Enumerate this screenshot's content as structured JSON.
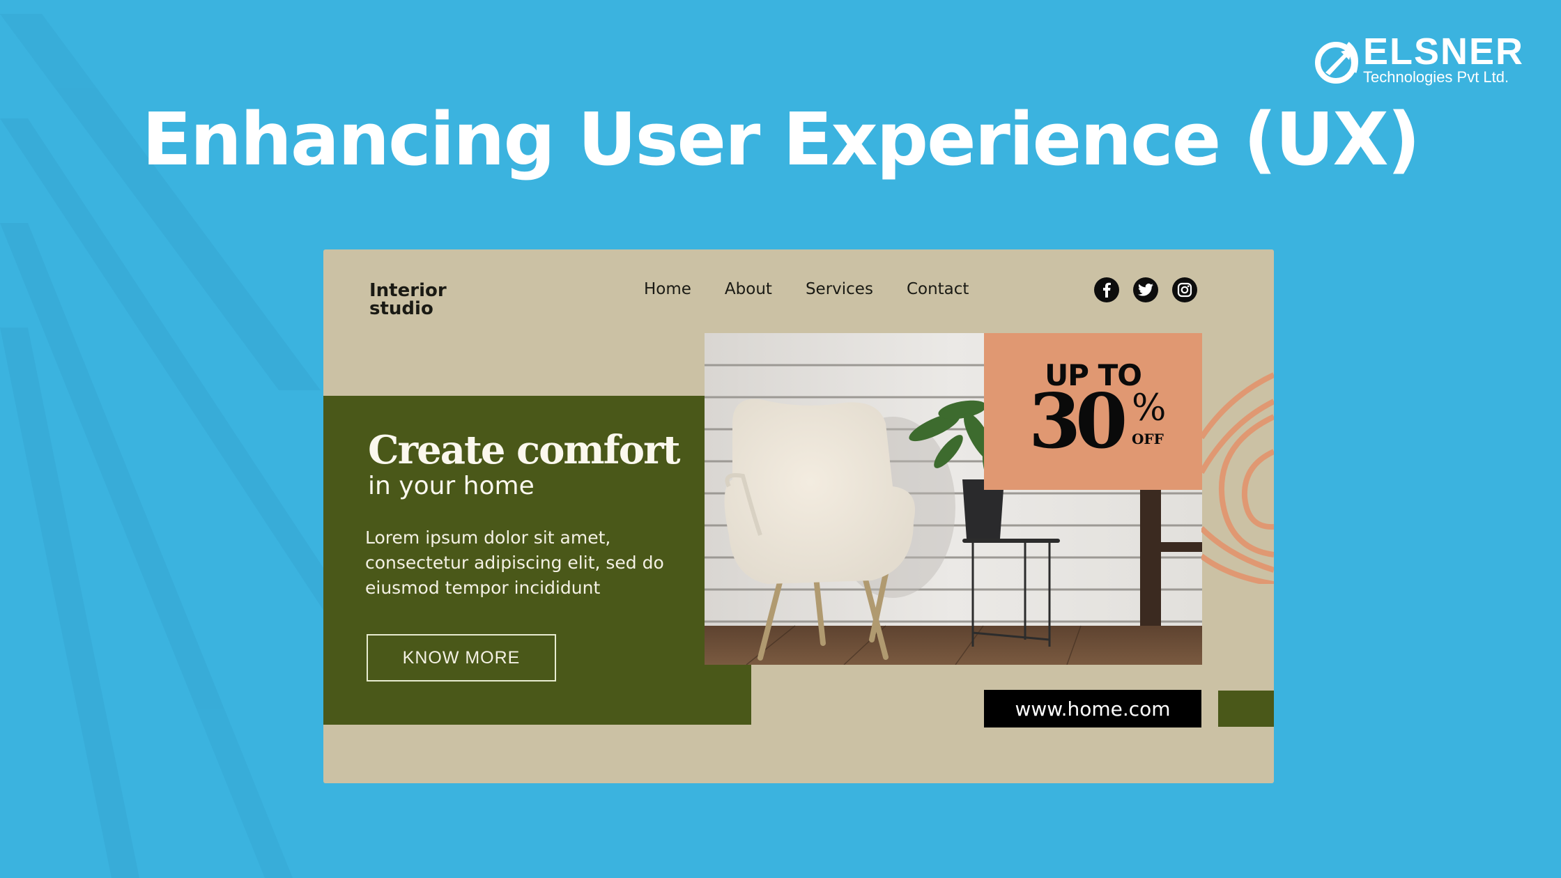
{
  "brand": {
    "name": "ELSNER",
    "subtitle": "Technologies Pvt Ltd.",
    "icon": "elsner-swoosh-icon"
  },
  "page": {
    "title": "Enhancing User Experience (UX)"
  },
  "mockup": {
    "logo_line1": "Interior",
    "logo_line2": "studio",
    "nav": [
      "Home",
      "About",
      "Services",
      "Contact"
    ],
    "social": [
      {
        "name": "facebook-icon",
        "glyph": "f"
      },
      {
        "name": "twitter-icon",
        "glyph": "bird"
      },
      {
        "name": "instagram-icon",
        "glyph": "camera"
      }
    ],
    "hero": {
      "title": "Create comfort",
      "subtitle": "in your home",
      "body": "Lorem ipsum dolor sit amet, consectetur adipiscing elit, sed do eiusmod tempor incididunt",
      "cta": "KNOW MORE"
    },
    "promo": {
      "line1": "UP TO",
      "number": "30",
      "percent": "%",
      "off": "OFF"
    },
    "url": "www.home.com",
    "photo_alt": "White boucle armchair beside a side table with potted plant"
  },
  "colors": {
    "background": "#3bb3df",
    "mockup_bg": "#cbc1a4",
    "green": "#4a5819",
    "peach": "#e09872",
    "black": "#000000"
  }
}
